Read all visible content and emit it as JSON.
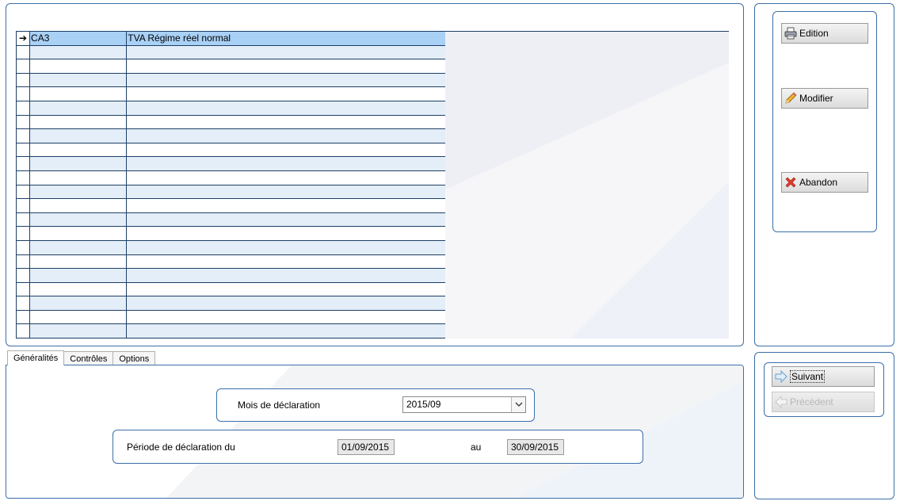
{
  "grid": {
    "rows": [
      {
        "code": "CA3",
        "label": "TVA Régime réel normal",
        "selected": true
      },
      {
        "code": "",
        "label": ""
      },
      {
        "code": "",
        "label": ""
      },
      {
        "code": "",
        "label": ""
      },
      {
        "code": "",
        "label": ""
      },
      {
        "code": "",
        "label": ""
      },
      {
        "code": "",
        "label": ""
      },
      {
        "code": "",
        "label": ""
      },
      {
        "code": "",
        "label": ""
      },
      {
        "code": "",
        "label": ""
      },
      {
        "code": "",
        "label": ""
      },
      {
        "code": "",
        "label": ""
      },
      {
        "code": "",
        "label": ""
      },
      {
        "code": "",
        "label": ""
      },
      {
        "code": "",
        "label": ""
      },
      {
        "code": "",
        "label": ""
      },
      {
        "code": "",
        "label": ""
      },
      {
        "code": "",
        "label": ""
      },
      {
        "code": "",
        "label": ""
      },
      {
        "code": "",
        "label": ""
      },
      {
        "code": "",
        "label": ""
      },
      {
        "code": "",
        "label": ""
      }
    ],
    "row_indicator": "➔"
  },
  "actions": {
    "edition": "Edition",
    "modifier": "Modifier",
    "abandon": "Abandon"
  },
  "nav": {
    "suivant": "Suivant",
    "precedent": "Précédent"
  },
  "tabs": [
    {
      "label": "Généralités",
      "active": true
    },
    {
      "label": "Contrôles"
    },
    {
      "label": "Options"
    }
  ],
  "form": {
    "mois_label": "Mois de déclaration",
    "mois_value": "2015/09",
    "periode_label": "Période de déclaration du",
    "date_from": "01/09/2015",
    "au_label": "au",
    "date_to": "30/09/2015"
  },
  "colors": {
    "border": "#3b6fa8",
    "selected_row": "#a9d0f5",
    "alt_row": "#e4eef8"
  }
}
